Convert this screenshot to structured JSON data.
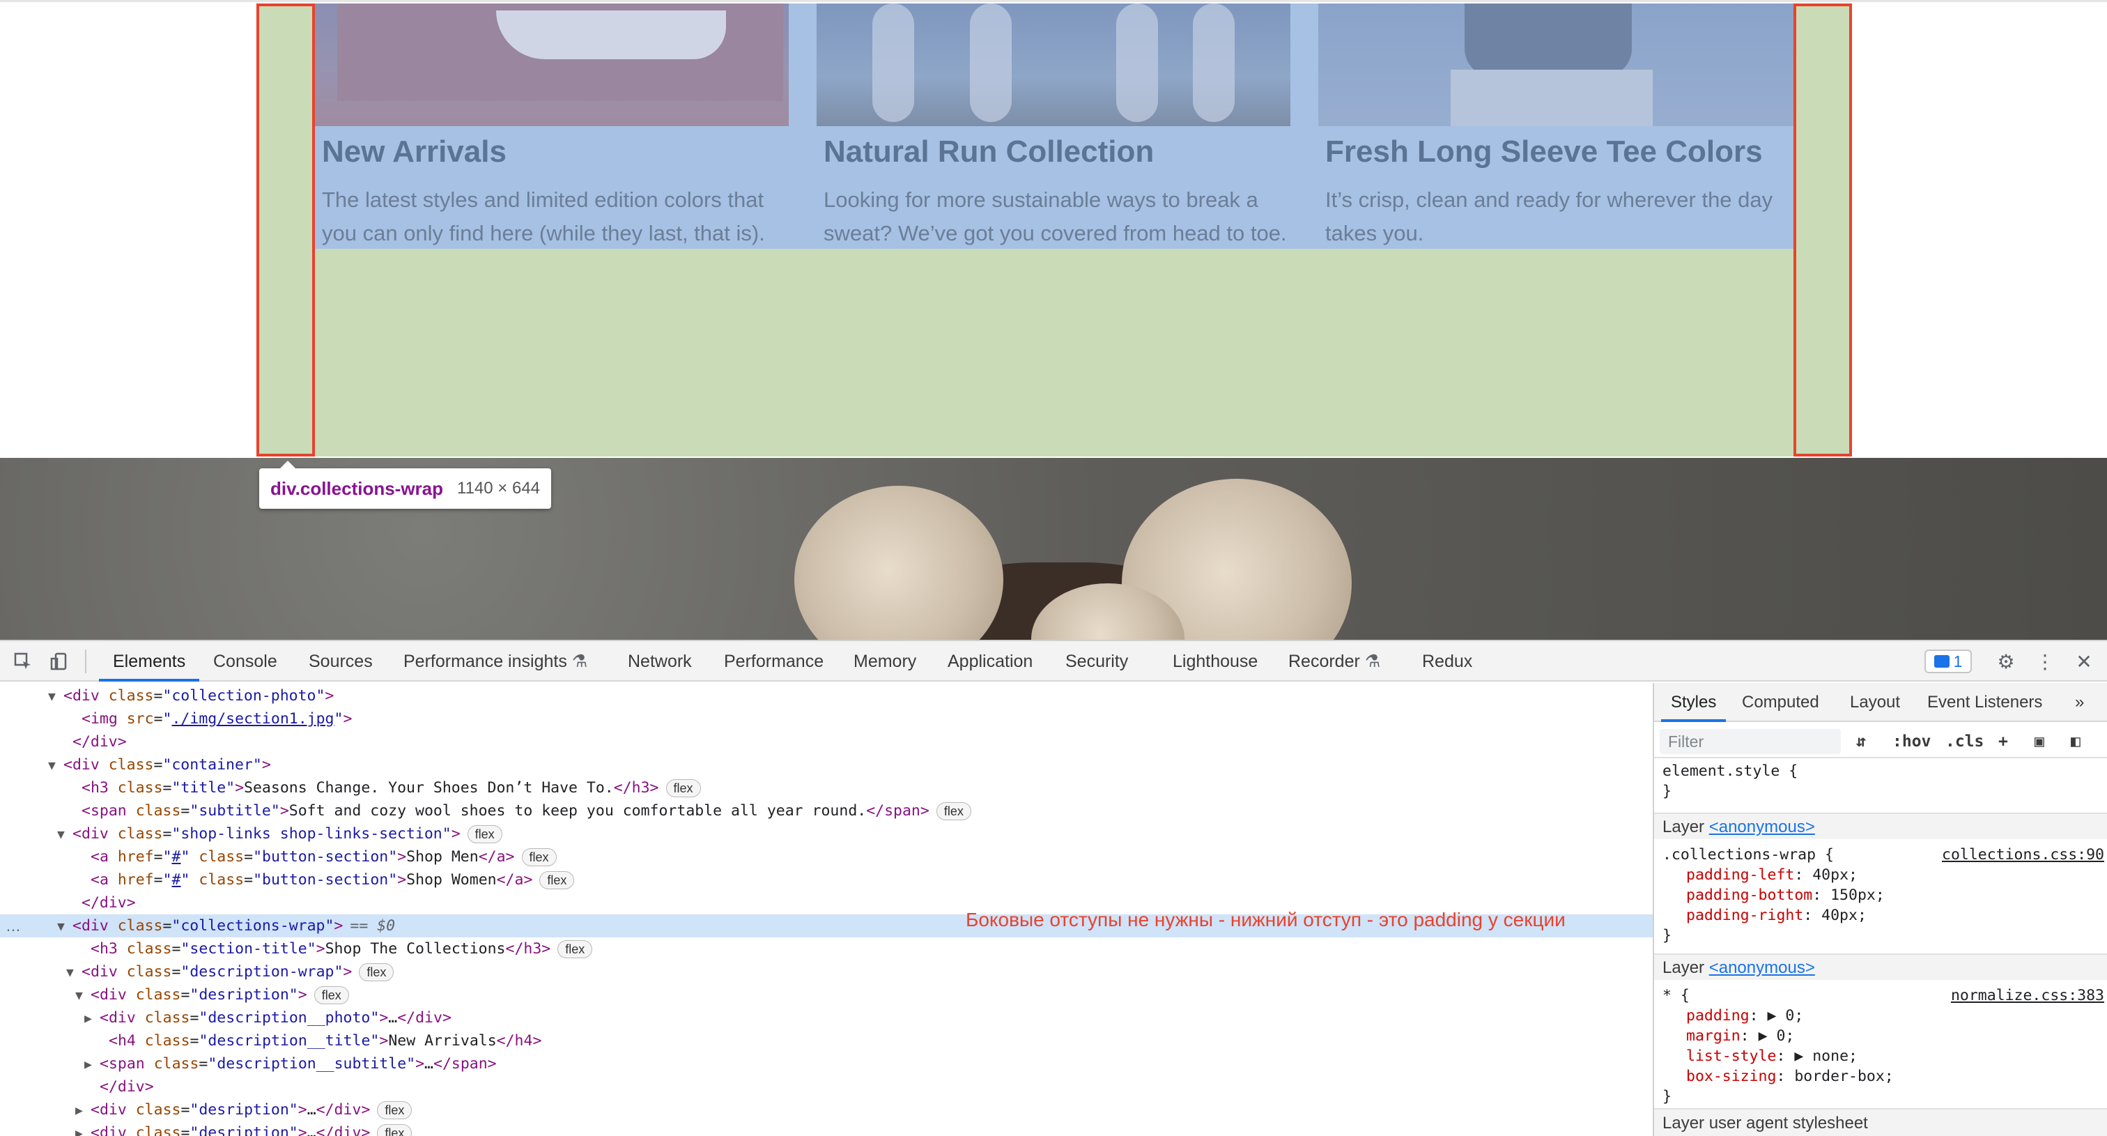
{
  "viewport": {
    "cards": [
      {
        "title": "New Arrivals",
        "subtitle_lines": [
          "The latest styles and limited edition colors that",
          "you can only find here (while they last, that is)."
        ]
      },
      {
        "title": "Natural Run Collection",
        "subtitle_lines": [
          "Looking for more sustainable ways to break a",
          "sweat? We’ve got you covered from head to toe."
        ]
      },
      {
        "title": "Fresh Long Sleeve Tee Colors",
        "subtitle_lines": [
          "It’s crisp, clean and ready for wherever the day",
          "takes you."
        ]
      }
    ],
    "tooltip": {
      "element": "div.collections-wrap",
      "size": "1140 × 644"
    },
    "colors": {
      "padding_overlay": "#c9dcb7",
      "content_overlay": "#a6c1e3",
      "annotation_border": "#e8432d"
    }
  },
  "devtools": {
    "toolbar": {
      "inspect_icon": "inspect-element-icon",
      "device_icon": "device-toolbar-icon",
      "tabs": [
        "Elements",
        "Console",
        "Sources",
        "Performance insights",
        "Network",
        "Performance",
        "Memory",
        "Application",
        "Security",
        "Lighthouse",
        "Recorder",
        "Redux"
      ],
      "active_tab": "Elements",
      "experimental_icon": "flask-icon",
      "issues_count": "1",
      "settings_icon": "gear-icon",
      "more_icon": "kebab-menu-icon",
      "close_icon": "close-icon"
    },
    "dom": {
      "ellipsis": "…",
      "selected_marker": "== $0",
      "annotation": "Боковые отступы не нужны - нижний отступ - это padding у секции",
      "lines": [
        {
          "indent": 3,
          "tri": "▼",
          "html": "<div class=\"collection-photo\">"
        },
        {
          "indent": 5,
          "tri": "",
          "html": "<img src=\"./img/section1.jpg\">"
        },
        {
          "indent": 4,
          "tri": "",
          "html": "</div>"
        },
        {
          "indent": 3,
          "tri": "▼",
          "html": "<div class=\"container\">"
        },
        {
          "indent": 5,
          "tri": "",
          "html": "<h3 class=\"title\">Seasons Change. Your Shoes Don’t Have To.</h3>",
          "pill": "flex"
        },
        {
          "indent": 5,
          "tri": "",
          "html": "<span class=\"subtitle\">Soft and cozy wool shoes to keep you comfortable all year round.</span>",
          "pill": "flex"
        },
        {
          "indent": 4,
          "tri": "▼",
          "html": "<div class=\"shop-links shop-links-section\">",
          "pill": "flex"
        },
        {
          "indent": 6,
          "tri": "",
          "html": "<a href=\"#\" class=\"button-section\">Shop Men</a>",
          "pill": "flex"
        },
        {
          "indent": 6,
          "tri": "",
          "html": "<a href=\"#\" class=\"button-section\">Shop Women</a>",
          "pill": "flex"
        },
        {
          "indent": 5,
          "tri": "",
          "html": "</div>"
        },
        {
          "indent": 4,
          "tri": "▼",
          "html": "<div class=\"collections-wrap\">",
          "selected": true
        },
        {
          "indent": 6,
          "tri": "",
          "html": "<h3 class=\"section-title\">Shop The Collections</h3>",
          "pill": "flex"
        },
        {
          "indent": 5,
          "tri": "▼",
          "html": "<div class=\"description-wrap\">",
          "pill": "flex"
        },
        {
          "indent": 6,
          "tri": "▼",
          "html": "<div class=\"desription\">",
          "pill": "flex"
        },
        {
          "indent": 7,
          "tri": "▶",
          "html": "<div class=\"description__photo\">…</div>"
        },
        {
          "indent": 8,
          "tri": "",
          "html": "<h4 class=\"description__title\">New Arrivals</h4>"
        },
        {
          "indent": 7,
          "tri": "▶",
          "html": "<span class=\"description__subtitle\">…</span>"
        },
        {
          "indent": 7,
          "tri": "",
          "html": "</div>"
        },
        {
          "indent": 6,
          "tri": "▶",
          "html": "<div class=\"desription\">…</div>",
          "pill": "flex"
        },
        {
          "indent": 6,
          "tri": "▶",
          "html": "<div class=\"desription\">…</div>",
          "pill": "flex"
        }
      ]
    },
    "styles_pane": {
      "tabs": [
        "Styles",
        "Computed",
        "Layout",
        "Event Listeners"
      ],
      "active_tab": "Styles",
      "overflow_icon": "chevron-double-right-icon",
      "filter_placeholder": "Filter",
      "hov": ":hov",
      "cls": ".cls",
      "plus": "+",
      "element_style": [
        "element.style {",
        "}"
      ],
      "layer1": {
        "label": "Layer",
        "name": "<anonymous>"
      },
      "rule1": {
        "selector": ".collections-wrap {",
        "source": "collections.css:90",
        "props": [
          [
            "padding-left",
            "40px;"
          ],
          [
            "padding-bottom",
            "150px;"
          ],
          [
            "padding-right",
            "40px;"
          ]
        ],
        "close": "}"
      },
      "layer2": {
        "label": "Layer",
        "name": "<anonymous>"
      },
      "rule2": {
        "selector": "* {",
        "source": "normalize.css:383",
        "props": [
          [
            "padding",
            "▶ 0;"
          ],
          [
            "margin",
            "▶ 0;"
          ],
          [
            "list-style",
            "▶ none;"
          ],
          [
            "box-sizing",
            "border-box;"
          ]
        ],
        "close": "}"
      },
      "user_agent": "Layer user agent stylesheet"
    }
  }
}
